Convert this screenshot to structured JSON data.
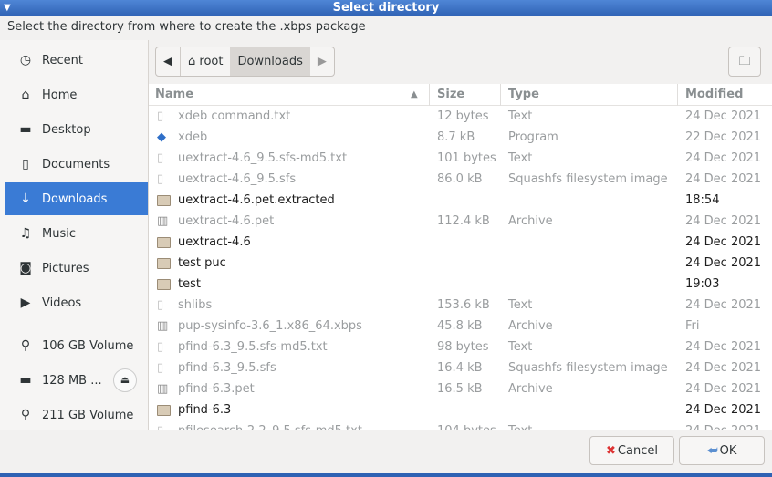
{
  "window": {
    "title": "Select directory",
    "prompt": "Select the directory from where to create the .xbps package"
  },
  "sidebar": {
    "items": [
      {
        "label": "Recent",
        "icon": "clock-icon"
      },
      {
        "label": "Home",
        "icon": "home-icon"
      },
      {
        "label": "Desktop",
        "icon": "folder-icon"
      },
      {
        "label": "Documents",
        "icon": "document-icon"
      },
      {
        "label": "Downloads",
        "icon": "download-icon",
        "selected": true
      },
      {
        "label": "Music",
        "icon": "music-icon"
      },
      {
        "label": "Pictures",
        "icon": "camera-icon"
      },
      {
        "label": "Videos",
        "icon": "video-icon"
      },
      {
        "label": "106 GB Volume",
        "icon": "usb-icon"
      },
      {
        "label": "128 MB ...",
        "icon": "drive-icon",
        "eject": true
      },
      {
        "label": "211 GB Volume",
        "icon": "usb-icon"
      }
    ]
  },
  "pathbar": {
    "segments": [
      "root",
      "Downloads"
    ]
  },
  "columns": {
    "name": "Name",
    "size": "Size",
    "type": "Type",
    "modified": "Modified"
  },
  "files": [
    {
      "name": "xdeb command.txt",
      "size": "12 bytes",
      "type": "Text",
      "modified": "24 Dec 2021",
      "kind": "text"
    },
    {
      "name": "xdeb",
      "size": "8.7 kB",
      "type": "Program",
      "modified": "22 Dec 2021",
      "kind": "program"
    },
    {
      "name": "uextract-4.6_9.5.sfs-md5.txt",
      "size": "101 bytes",
      "type": "Text",
      "modified": "24 Dec 2021",
      "kind": "text"
    },
    {
      "name": "uextract-4.6_9.5.sfs",
      "size": "86.0 kB",
      "type": "Squashfs filesystem image",
      "modified": "24 Dec 2021",
      "kind": "text"
    },
    {
      "name": "uextract-4.6.pet.extracted",
      "size": "",
      "type": "",
      "modified": "18:54",
      "kind": "folder"
    },
    {
      "name": "uextract-4.6.pet",
      "size": "112.4 kB",
      "type": "Archive",
      "modified": "24 Dec 2021",
      "kind": "archive"
    },
    {
      "name": "uextract-4.6",
      "size": "",
      "type": "",
      "modified": "24 Dec 2021",
      "kind": "folder"
    },
    {
      "name": "test puc",
      "size": "",
      "type": "",
      "modified": "24 Dec 2021",
      "kind": "folder"
    },
    {
      "name": "test",
      "size": "",
      "type": "",
      "modified": "19:03",
      "kind": "folder"
    },
    {
      "name": "shlibs",
      "size": "153.6 kB",
      "type": "Text",
      "modified": "24 Dec 2021",
      "kind": "text"
    },
    {
      "name": "pup-sysinfo-3.6_1.x86_64.xbps",
      "size": "45.8 kB",
      "type": "Archive",
      "modified": "Fri",
      "kind": "archive"
    },
    {
      "name": "pfind-6.3_9.5.sfs-md5.txt",
      "size": "98 bytes",
      "type": "Text",
      "modified": "24 Dec 2021",
      "kind": "text"
    },
    {
      "name": "pfind-6.3_9.5.sfs",
      "size": "16.4 kB",
      "type": "Squashfs filesystem image",
      "modified": "24 Dec 2021",
      "kind": "text"
    },
    {
      "name": "pfind-6.3.pet",
      "size": "16.5 kB",
      "type": "Archive",
      "modified": "24 Dec 2021",
      "kind": "archive"
    },
    {
      "name": "pfind-6.3",
      "size": "",
      "type": "",
      "modified": "24 Dec 2021",
      "kind": "folder"
    },
    {
      "name": "pfilesearch-2.2_9.5.sfs-md5.txt",
      "size": "104 bytes",
      "type": "Text",
      "modified": "24 Dec 2021",
      "kind": "text"
    }
  ],
  "buttons": {
    "cancel": "Cancel",
    "ok": "OK"
  }
}
